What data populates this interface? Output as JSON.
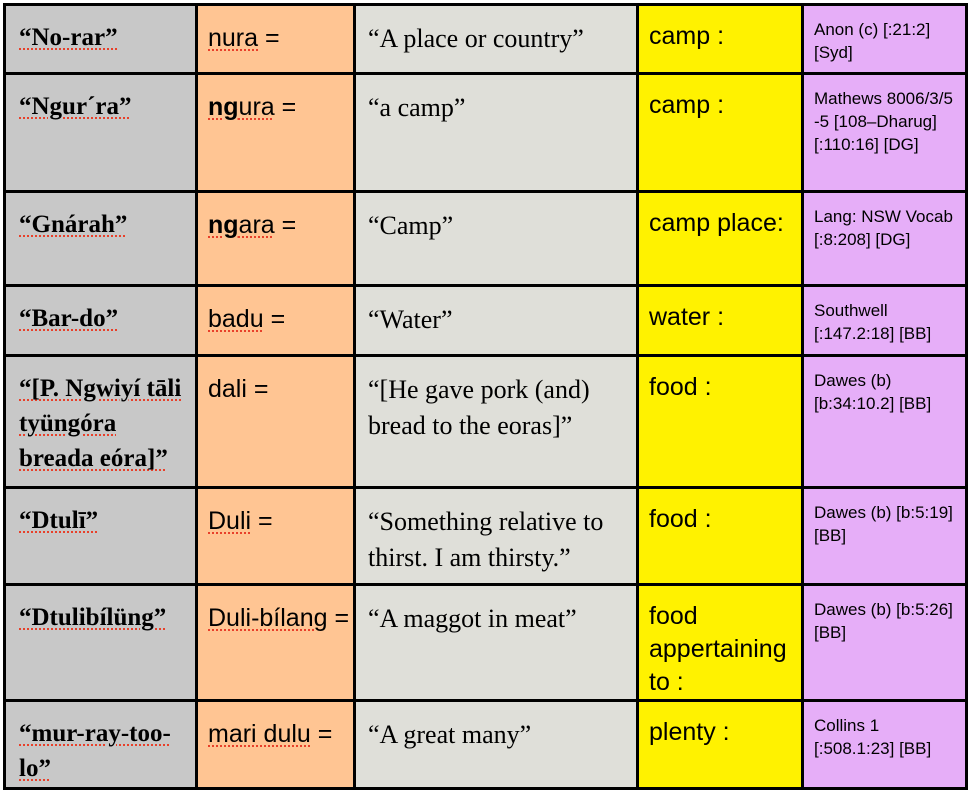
{
  "table": {
    "columns": [
      "original_spelling",
      "normalised_form",
      "gloss",
      "semantic_domain",
      "source"
    ],
    "colors": {
      "original_spelling": "#c8c8c8",
      "normalised_form": "#ffc593",
      "gloss": "#dfdfd9",
      "semantic_domain": "#fff200",
      "source": "#e6aef8",
      "spellcheck_underline": "#e8402a"
    },
    "rows": [
      {
        "original": "“No-rar”",
        "normalised_pre": "",
        "normalised_bold": "",
        "normalised_rest": "nura",
        "normalised_suffix": " =",
        "gloss": "“A place or country”",
        "semantic": "camp  :",
        "source": "Anon (c) [:21:2] [Syd]"
      },
      {
        "original": "“Ngur´ra”",
        "normalised_pre": "",
        "normalised_bold": "ng",
        "normalised_rest": "ura",
        "normalised_suffix": " =",
        "gloss": "“a camp”",
        "semantic": "camp  :",
        "source": "Mathews 8006/3/5 -5 [108–Dharug] [:110:16] [DG]"
      },
      {
        "original": "“Gnárah”",
        "normalised_pre": "",
        "normalised_bold": "ng",
        "normalised_rest": "ara",
        "normalised_suffix": " =",
        "gloss": "“Camp”",
        "semantic": "camp place:",
        "source": "Lang: NSW Vocab [:8:208] [DG]"
      },
      {
        "original": "“Bar-do”",
        "normalised_pre": "",
        "normalised_bold": "",
        "normalised_rest": "badu",
        "normalised_suffix": " =",
        "gloss": "“Water”",
        "semantic": "water  :",
        "source": "Southwell [:147.2:18] [BB]"
      },
      {
        "original": "“[P. Ngwiyí tāli tyüngóra breada eóra]”",
        "normalised_pre": "dali",
        "normalised_bold": "",
        "normalised_rest": "",
        "normalised_suffix": " =",
        "gloss": "“[He gave pork (and) bread to the eoras]”",
        "semantic": "food  :",
        "source": "Dawes (b) [b:34:10.2] [BB]"
      },
      {
        "original": "“Dtulī”",
        "normalised_pre": "",
        "normalised_bold": "",
        "normalised_rest": "Duli",
        "normalised_suffix": " =",
        "gloss": "“Something relative to thirst. I am thirsty.”",
        "semantic": "food  :",
        "source": "Dawes (b) [b:5:19] [BB]"
      },
      {
        "original": "“Dtulibílüng”",
        "normalised_pre": "",
        "normalised_bold": "",
        "normalised_rest": "Duli-bílang",
        "normalised_suffix": " =",
        "gloss": "“A maggot in meat”",
        "semantic": "food appertaining to :",
        "source": "Dawes (b) [b:5:26] [BB]"
      },
      {
        "original": "“mur-ray-too-lo”",
        "normalised_pre": "",
        "normalised_bold": "",
        "normalised_rest": "mari dulu",
        "normalised_suffix": " =",
        "gloss": "“A great many”",
        "semantic": "plenty  :",
        "source": "Collins 1 [:508.1:23] [BB]"
      }
    ]
  }
}
